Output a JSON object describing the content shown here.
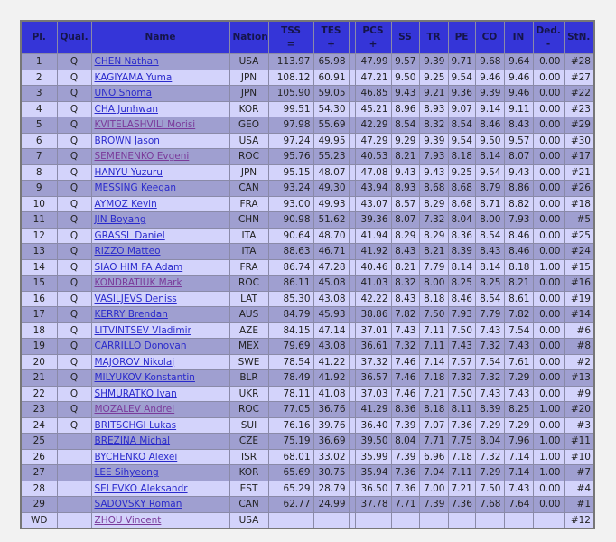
{
  "headers": [
    {
      "label": "Pl.",
      "sub": ""
    },
    {
      "label": "Qual.",
      "sub": ""
    },
    {
      "label": "Name",
      "sub": ""
    },
    {
      "label": "Nation",
      "sub": ""
    },
    {
      "label": "TSS",
      "sub": "="
    },
    {
      "label": "TES",
      "sub": "+"
    },
    {
      "label": "",
      "sub": ""
    },
    {
      "label": "PCS",
      "sub": "+"
    },
    {
      "label": "SS",
      "sub": ""
    },
    {
      "label": "TR",
      "sub": ""
    },
    {
      "label": "PE",
      "sub": ""
    },
    {
      "label": "CO",
      "sub": ""
    },
    {
      "label": "IN",
      "sub": ""
    },
    {
      "label": "Ded.",
      "sub": "-"
    },
    {
      "label": "StN.",
      "sub": ""
    }
  ],
  "colors": {
    "header": "#3535d8",
    "row_dark": "#9f9fd0",
    "row_light": "#d3d3fb",
    "link": "#2a2acc",
    "link_visited": "#7a3a9a"
  },
  "rows": [
    {
      "pl": "1",
      "q": "Q",
      "name": "CHEN Nathan",
      "visited": false,
      "nat": "USA",
      "tss": "113.97",
      "tes": "65.98",
      "pcs": "47.99",
      "ss": "9.57",
      "tr": "9.39",
      "pe": "9.71",
      "co": "9.68",
      "in": "9.64",
      "ded": "0.00",
      "stn": "#28"
    },
    {
      "pl": "2",
      "q": "Q",
      "name": "KAGIYAMA Yuma",
      "visited": false,
      "nat": "JPN",
      "tss": "108.12",
      "tes": "60.91",
      "pcs": "47.21",
      "ss": "9.50",
      "tr": "9.25",
      "pe": "9.54",
      "co": "9.46",
      "in": "9.46",
      "ded": "0.00",
      "stn": "#27"
    },
    {
      "pl": "3",
      "q": "Q",
      "name": "UNO Shoma",
      "visited": false,
      "nat": "JPN",
      "tss": "105.90",
      "tes": "59.05",
      "pcs": "46.85",
      "ss": "9.43",
      "tr": "9.21",
      "pe": "9.36",
      "co": "9.39",
      "in": "9.46",
      "ded": "0.00",
      "stn": "#22"
    },
    {
      "pl": "4",
      "q": "Q",
      "name": "CHA Junhwan",
      "visited": false,
      "nat": "KOR",
      "tss": "99.51",
      "tes": "54.30",
      "pcs": "45.21",
      "ss": "8.96",
      "tr": "8.93",
      "pe": "9.07",
      "co": "9.14",
      "in": "9.11",
      "ded": "0.00",
      "stn": "#23"
    },
    {
      "pl": "5",
      "q": "Q",
      "name": "KVITELASHVILI Morisi",
      "visited": true,
      "nat": "GEO",
      "tss": "97.98",
      "tes": "55.69",
      "pcs": "42.29",
      "ss": "8.54",
      "tr": "8.32",
      "pe": "8.54",
      "co": "8.46",
      "in": "8.43",
      "ded": "0.00",
      "stn": "#29"
    },
    {
      "pl": "6",
      "q": "Q",
      "name": "BROWN Jason",
      "visited": false,
      "nat": "USA",
      "tss": "97.24",
      "tes": "49.95",
      "pcs": "47.29",
      "ss": "9.29",
      "tr": "9.39",
      "pe": "9.54",
      "co": "9.50",
      "in": "9.57",
      "ded": "0.00",
      "stn": "#30"
    },
    {
      "pl": "7",
      "q": "Q",
      "name": "SEMENENKO Evgeni",
      "visited": true,
      "nat": "ROC",
      "tss": "95.76",
      "tes": "55.23",
      "pcs": "40.53",
      "ss": "8.21",
      "tr": "7.93",
      "pe": "8.18",
      "co": "8.14",
      "in": "8.07",
      "ded": "0.00",
      "stn": "#17"
    },
    {
      "pl": "8",
      "q": "Q",
      "name": "HANYU Yuzuru",
      "visited": false,
      "nat": "JPN",
      "tss": "95.15",
      "tes": "48.07",
      "pcs": "47.08",
      "ss": "9.43",
      "tr": "9.43",
      "pe": "9.25",
      "co": "9.54",
      "in": "9.43",
      "ded": "0.00",
      "stn": "#21"
    },
    {
      "pl": "9",
      "q": "Q",
      "name": "MESSING Keegan",
      "visited": false,
      "nat": "CAN",
      "tss": "93.24",
      "tes": "49.30",
      "pcs": "43.94",
      "ss": "8.93",
      "tr": "8.68",
      "pe": "8.68",
      "co": "8.79",
      "in": "8.86",
      "ded": "0.00",
      "stn": "#26"
    },
    {
      "pl": "10",
      "q": "Q",
      "name": "AYMOZ Kevin",
      "visited": false,
      "nat": "FRA",
      "tss": "93.00",
      "tes": "49.93",
      "pcs": "43.07",
      "ss": "8.57",
      "tr": "8.29",
      "pe": "8.68",
      "co": "8.71",
      "in": "8.82",
      "ded": "0.00",
      "stn": "#18"
    },
    {
      "pl": "11",
      "q": "Q",
      "name": "JIN Boyang",
      "visited": false,
      "nat": "CHN",
      "tss": "90.98",
      "tes": "51.62",
      "pcs": "39.36",
      "ss": "8.07",
      "tr": "7.32",
      "pe": "8.04",
      "co": "8.00",
      "in": "7.93",
      "ded": "0.00",
      "stn": "#5"
    },
    {
      "pl": "12",
      "q": "Q",
      "name": "GRASSL Daniel",
      "visited": false,
      "nat": "ITA",
      "tss": "90.64",
      "tes": "48.70",
      "pcs": "41.94",
      "ss": "8.29",
      "tr": "8.29",
      "pe": "8.36",
      "co": "8.54",
      "in": "8.46",
      "ded": "0.00",
      "stn": "#25"
    },
    {
      "pl": "13",
      "q": "Q",
      "name": "RIZZO Matteo",
      "visited": false,
      "nat": "ITA",
      "tss": "88.63",
      "tes": "46.71",
      "pcs": "41.92",
      "ss": "8.43",
      "tr": "8.21",
      "pe": "8.39",
      "co": "8.43",
      "in": "8.46",
      "ded": "0.00",
      "stn": "#24"
    },
    {
      "pl": "14",
      "q": "Q",
      "name": "SIAO HIM FA Adam",
      "visited": false,
      "nat": "FRA",
      "tss": "86.74",
      "tes": "47.28",
      "pcs": "40.46",
      "ss": "8.21",
      "tr": "7.79",
      "pe": "8.14",
      "co": "8.14",
      "in": "8.18",
      "ded": "1.00",
      "stn": "#15"
    },
    {
      "pl": "15",
      "q": "Q",
      "name": "KONDRATIUK Mark",
      "visited": true,
      "nat": "ROC",
      "tss": "86.11",
      "tes": "45.08",
      "pcs": "41.03",
      "ss": "8.32",
      "tr": "8.00",
      "pe": "8.25",
      "co": "8.25",
      "in": "8.21",
      "ded": "0.00",
      "stn": "#16"
    },
    {
      "pl": "16",
      "q": "Q",
      "name": "VASILJEVS Deniss",
      "visited": false,
      "nat": "LAT",
      "tss": "85.30",
      "tes": "43.08",
      "pcs": "42.22",
      "ss": "8.43",
      "tr": "8.18",
      "pe": "8.46",
      "co": "8.54",
      "in": "8.61",
      "ded": "0.00",
      "stn": "#19"
    },
    {
      "pl": "17",
      "q": "Q",
      "name": "KERRY Brendan",
      "visited": false,
      "nat": "AUS",
      "tss": "84.79",
      "tes": "45.93",
      "pcs": "38.86",
      "ss": "7.82",
      "tr": "7.50",
      "pe": "7.93",
      "co": "7.79",
      "in": "7.82",
      "ded": "0.00",
      "stn": "#14"
    },
    {
      "pl": "18",
      "q": "Q",
      "name": "LITVINTSEV Vladimir",
      "visited": false,
      "nat": "AZE",
      "tss": "84.15",
      "tes": "47.14",
      "pcs": "37.01",
      "ss": "7.43",
      "tr": "7.11",
      "pe": "7.50",
      "co": "7.43",
      "in": "7.54",
      "ded": "0.00",
      "stn": "#6"
    },
    {
      "pl": "19",
      "q": "Q",
      "name": "CARRILLO Donovan",
      "visited": false,
      "nat": "MEX",
      "tss": "79.69",
      "tes": "43.08",
      "pcs": "36.61",
      "ss": "7.32",
      "tr": "7.11",
      "pe": "7.43",
      "co": "7.32",
      "in": "7.43",
      "ded": "0.00",
      "stn": "#8"
    },
    {
      "pl": "20",
      "q": "Q",
      "name": "MAJOROV Nikolaj",
      "visited": false,
      "nat": "SWE",
      "tss": "78.54",
      "tes": "41.22",
      "pcs": "37.32",
      "ss": "7.46",
      "tr": "7.14",
      "pe": "7.57",
      "co": "7.54",
      "in": "7.61",
      "ded": "0.00",
      "stn": "#2"
    },
    {
      "pl": "21",
      "q": "Q",
      "name": "MILYUKOV Konstantin",
      "visited": false,
      "nat": "BLR",
      "tss": "78.49",
      "tes": "41.92",
      "pcs": "36.57",
      "ss": "7.46",
      "tr": "7.18",
      "pe": "7.32",
      "co": "7.32",
      "in": "7.29",
      "ded": "0.00",
      "stn": "#13"
    },
    {
      "pl": "22",
      "q": "Q",
      "name": "SHMURATKO Ivan",
      "visited": false,
      "nat": "UKR",
      "tss": "78.11",
      "tes": "41.08",
      "pcs": "37.03",
      "ss": "7.46",
      "tr": "7.21",
      "pe": "7.50",
      "co": "7.43",
      "in": "7.43",
      "ded": "0.00",
      "stn": "#9"
    },
    {
      "pl": "23",
      "q": "Q",
      "name": "MOZALEV Andrei",
      "visited": true,
      "nat": "ROC",
      "tss": "77.05",
      "tes": "36.76",
      "pcs": "41.29",
      "ss": "8.36",
      "tr": "8.18",
      "pe": "8.11",
      "co": "8.39",
      "in": "8.25",
      "ded": "1.00",
      "stn": "#20"
    },
    {
      "pl": "24",
      "q": "Q",
      "name": "BRITSCHGI Lukas",
      "visited": false,
      "nat": "SUI",
      "tss": "76.16",
      "tes": "39.76",
      "pcs": "36.40",
      "ss": "7.39",
      "tr": "7.07",
      "pe": "7.36",
      "co": "7.29",
      "in": "7.29",
      "ded": "0.00",
      "stn": "#3"
    },
    {
      "pl": "25",
      "q": "",
      "name": "BREZINA Michal",
      "visited": false,
      "nat": "CZE",
      "tss": "75.19",
      "tes": "36.69",
      "pcs": "39.50",
      "ss": "8.04",
      "tr": "7.71",
      "pe": "7.75",
      "co": "8.04",
      "in": "7.96",
      "ded": "1.00",
      "stn": "#11"
    },
    {
      "pl": "26",
      "q": "",
      "name": "BYCHENKO Alexei",
      "visited": false,
      "nat": "ISR",
      "tss": "68.01",
      "tes": "33.02",
      "pcs": "35.99",
      "ss": "7.39",
      "tr": "6.96",
      "pe": "7.18",
      "co": "7.32",
      "in": "7.14",
      "ded": "1.00",
      "stn": "#10"
    },
    {
      "pl": "27",
      "q": "",
      "name": "LEE Sihyeong",
      "visited": false,
      "nat": "KOR",
      "tss": "65.69",
      "tes": "30.75",
      "pcs": "35.94",
      "ss": "7.36",
      "tr": "7.04",
      "pe": "7.11",
      "co": "7.29",
      "in": "7.14",
      "ded": "1.00",
      "stn": "#7"
    },
    {
      "pl": "28",
      "q": "",
      "name": "SELEVKO Aleksandr",
      "visited": false,
      "nat": "EST",
      "tss": "65.29",
      "tes": "28.79",
      "pcs": "36.50",
      "ss": "7.36",
      "tr": "7.00",
      "pe": "7.21",
      "co": "7.50",
      "in": "7.43",
      "ded": "0.00",
      "stn": "#4"
    },
    {
      "pl": "29",
      "q": "",
      "name": "SADOVSKY Roman",
      "visited": false,
      "nat": "CAN",
      "tss": "62.77",
      "tes": "24.99",
      "pcs": "37.78",
      "ss": "7.71",
      "tr": "7.39",
      "pe": "7.36",
      "co": "7.68",
      "co2": "",
      "in": "7.64",
      "ded": "0.00",
      "stn": "#1"
    },
    {
      "pl": "WD",
      "q": "",
      "name": "ZHOU Vincent",
      "visited": true,
      "nat": "USA",
      "tss": "",
      "tes": "",
      "pcs": "",
      "ss": "",
      "tr": "",
      "pe": "",
      "co": "",
      "in": "",
      "ded": "",
      "stn": "#12"
    }
  ]
}
